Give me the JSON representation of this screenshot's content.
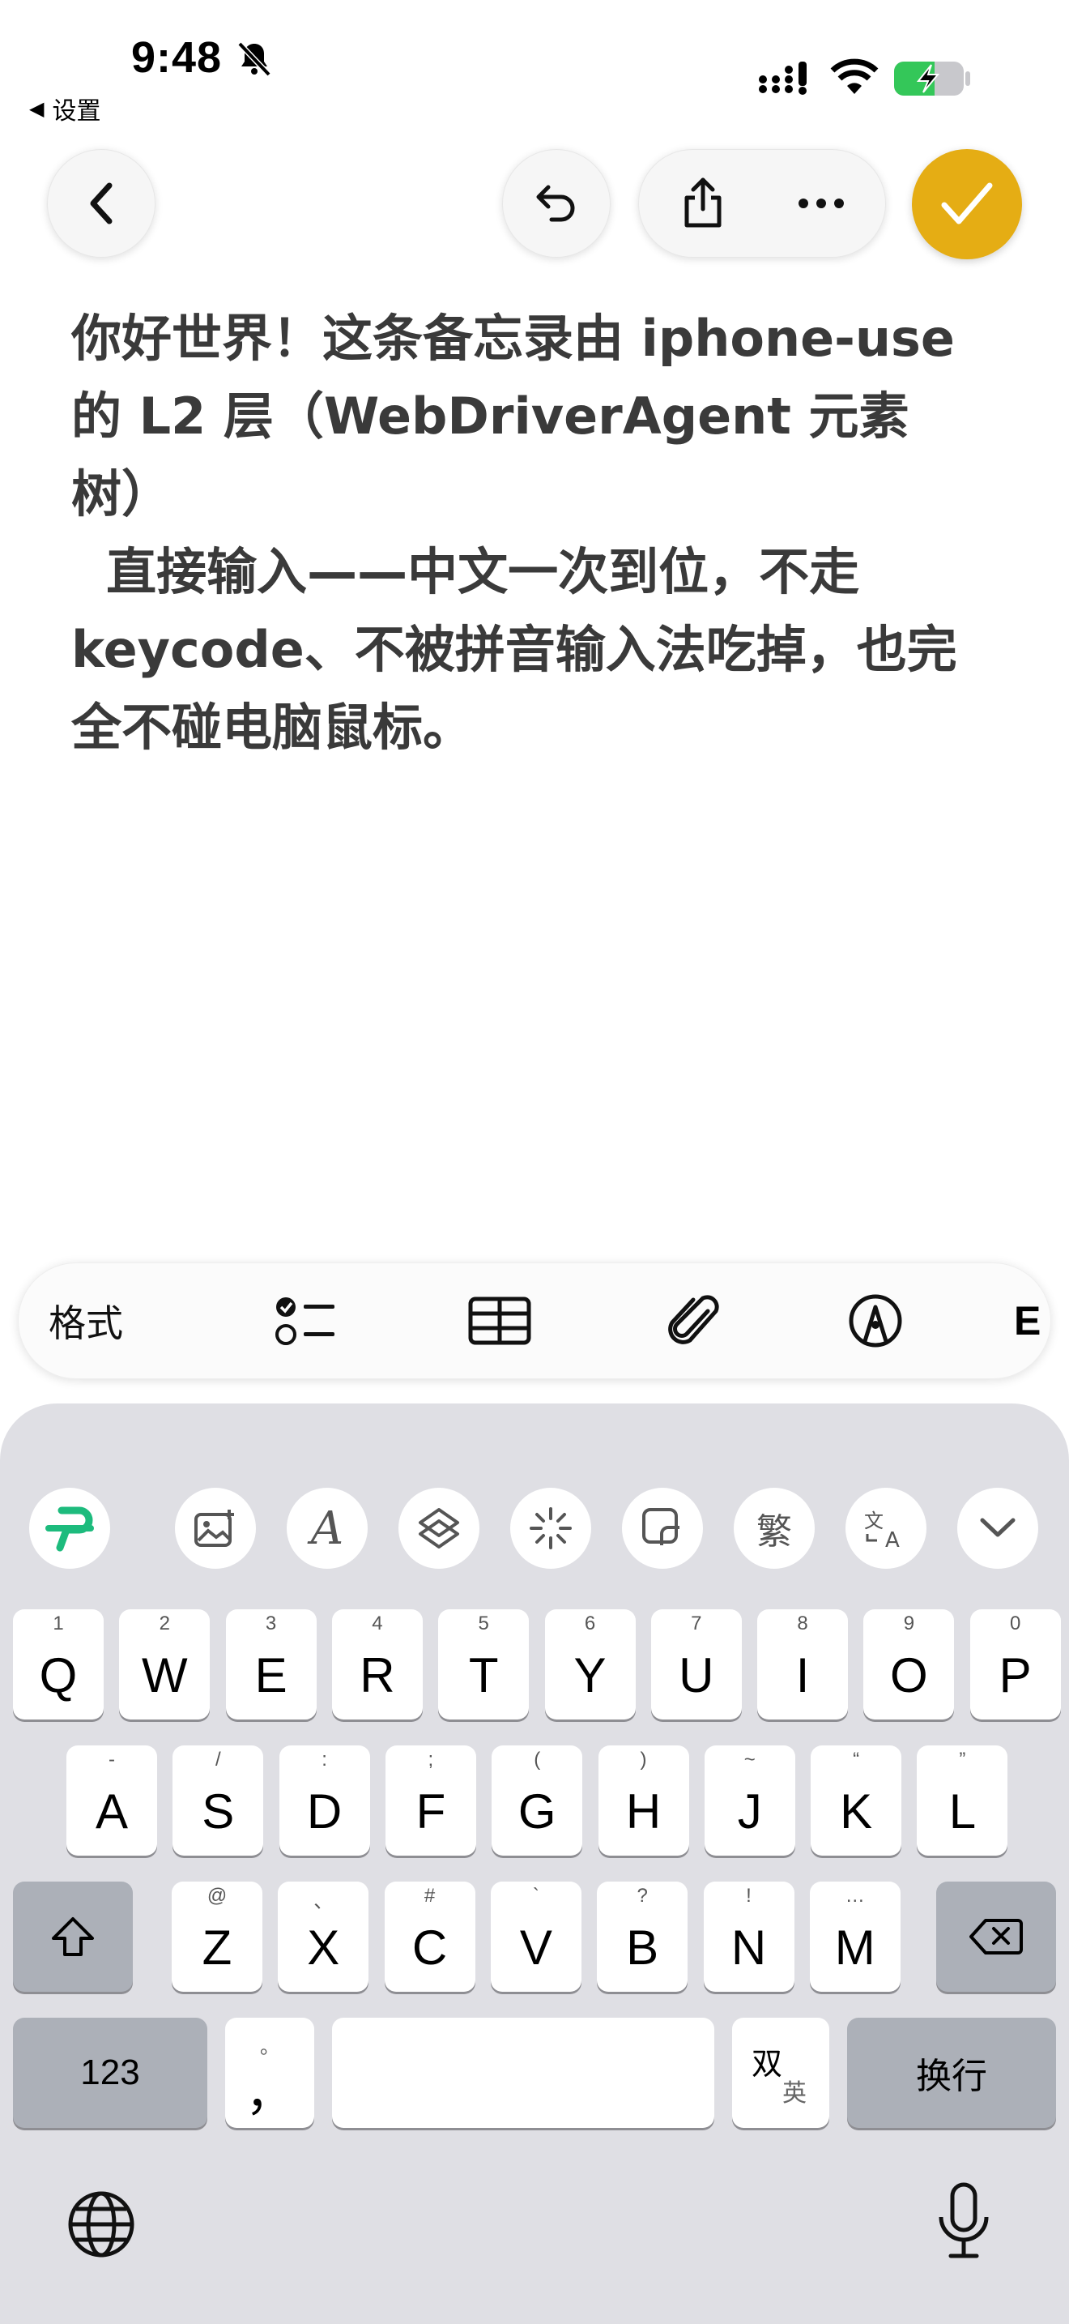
{
  "status_bar": {
    "time": "9:48",
    "back_app": "设置"
  },
  "note": {
    "text": "你好世界！这条备忘录由 iphone-use\n的 L2 层（WebDriverAgent 元素树）\n  直接输入——中文一次到位，不走\nkeycode、不被拼音输入法吃掉，也完\n全不碰电脑鼠标。"
  },
  "toolbar": {
    "format_label": "格式"
  },
  "keyboard": {
    "row1": [
      {
        "key": "Q",
        "hint": "1"
      },
      {
        "key": "W",
        "hint": "2"
      },
      {
        "key": "E",
        "hint": "3"
      },
      {
        "key": "R",
        "hint": "4"
      },
      {
        "key": "T",
        "hint": "5"
      },
      {
        "key": "Y",
        "hint": "6"
      },
      {
        "key": "U",
        "hint": "7"
      },
      {
        "key": "I",
        "hint": "8"
      },
      {
        "key": "O",
        "hint": "9"
      },
      {
        "key": "P",
        "hint": "0"
      }
    ],
    "row2": [
      {
        "key": "A",
        "hint": "-"
      },
      {
        "key": "S",
        "hint": "/"
      },
      {
        "key": "D",
        "hint": ":"
      },
      {
        "key": "F",
        "hint": ";"
      },
      {
        "key": "G",
        "hint": "("
      },
      {
        "key": "H",
        "hint": ")"
      },
      {
        "key": "J",
        "hint": "~"
      },
      {
        "key": "K",
        "hint": "“"
      },
      {
        "key": "L",
        "hint": "”"
      }
    ],
    "row3": [
      {
        "key": "Z",
        "hint": "@"
      },
      {
        "key": "X",
        "hint": "、"
      },
      {
        "key": "C",
        "hint": "#"
      },
      {
        "key": "V",
        "hint": "`"
      },
      {
        "key": "B",
        "hint": "?"
      },
      {
        "key": "N",
        "hint": "!"
      },
      {
        "key": "M",
        "hint": "…"
      }
    ],
    "numbers_key": "123",
    "punct_key": "，",
    "punct_hint": "。",
    "lang_key_top": "双",
    "lang_key_bottom": "英",
    "return_key": "换行",
    "traditional_label": "繁"
  },
  "colors": {
    "accent": "#e5ad14",
    "keyboard_bg": "#dfdfe4",
    "dark_key": "#acb0b8",
    "battery": "#34c759",
    "brand_green": "#1dbb7d"
  }
}
